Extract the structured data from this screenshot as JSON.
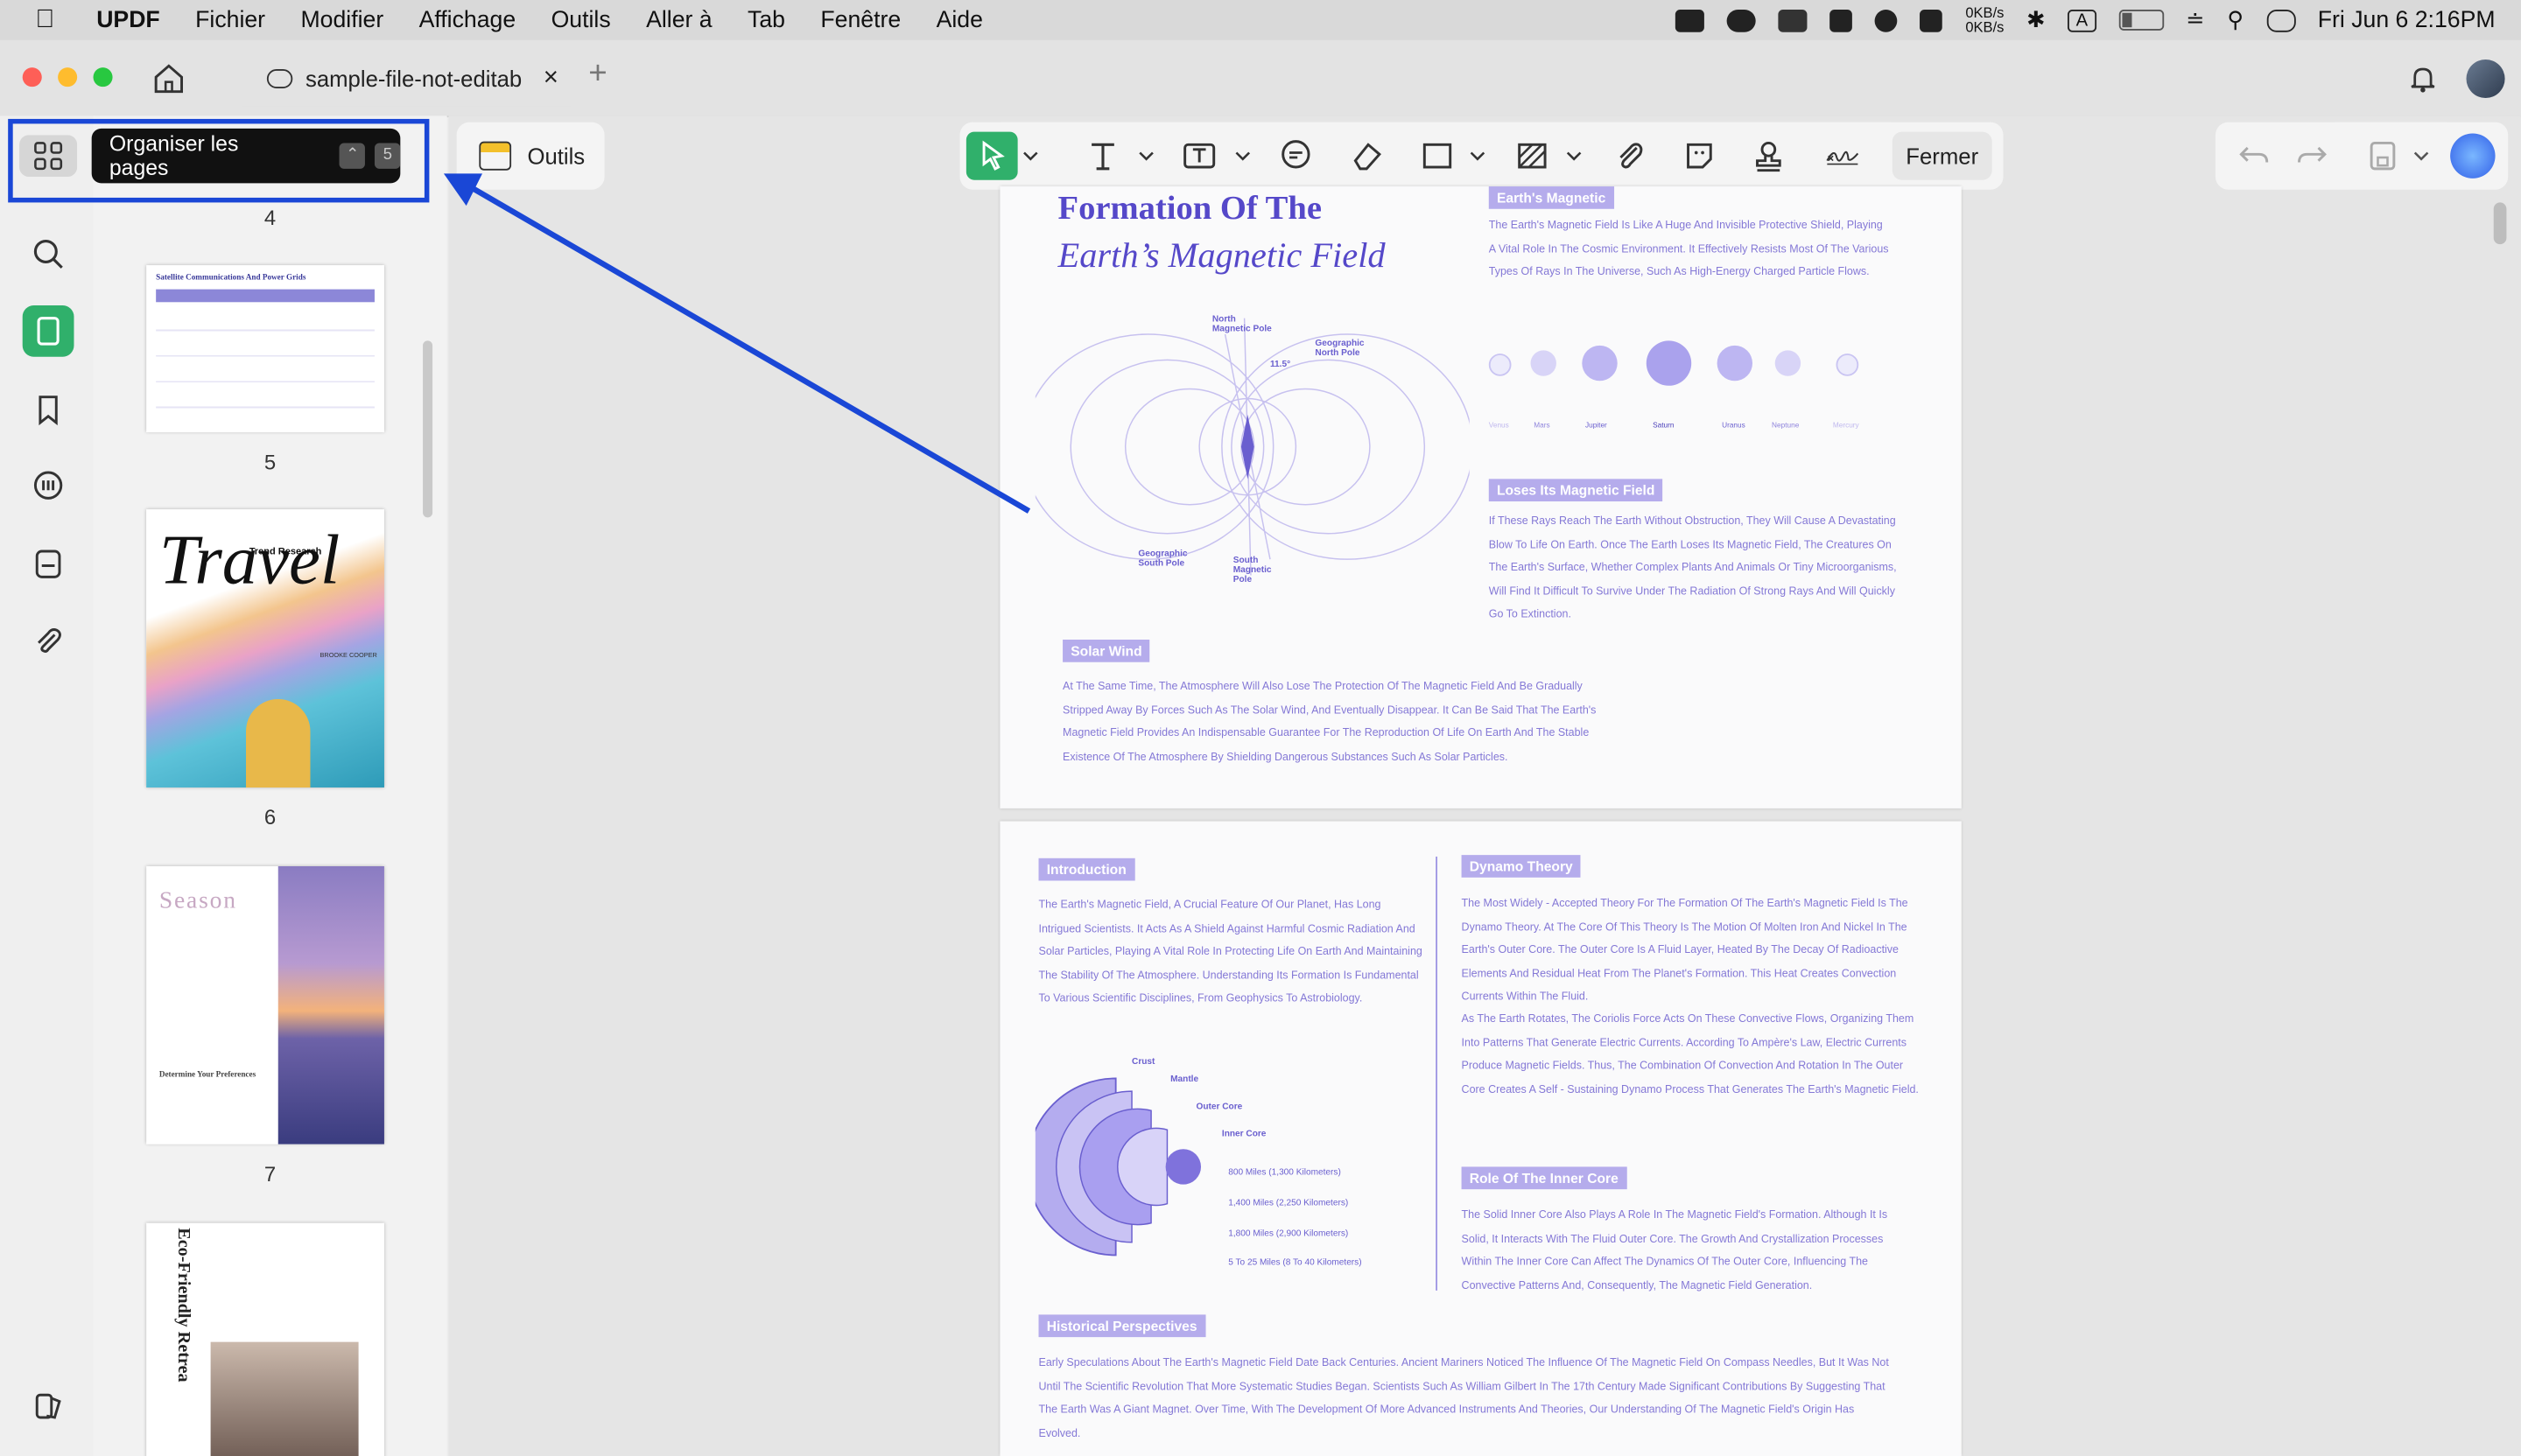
{
  "menubar": {
    "app": "UPDF",
    "items": [
      "Fichier",
      "Modifier",
      "Affichage",
      "Outils",
      "Aller à",
      "Tab",
      "Fenêtre",
      "Aide"
    ],
    "net_up": "0KB/s",
    "net_down": "0KB/s",
    "clock": "Fri Jun 6  2:16PM"
  },
  "tabbar": {
    "doc_tab": "sample-file-not-editab",
    "close": "×",
    "new_tab": "+"
  },
  "tooltip": {
    "label": "Organiser les pages",
    "key1": "⌃",
    "key2": "5"
  },
  "thumbnails": {
    "page_numbers": [
      "4",
      "5",
      "6",
      "7"
    ],
    "t5_title": "Satellite Communications And Power Grids",
    "t6_title": "Travel",
    "t6_sub": "Trend Research",
    "t6_author": "BROOKE COOPER",
    "t7_title": "Season",
    "t7_heading": "Determine Your Preferences",
    "t8_title": "Eco-Friendly Retrea"
  },
  "toolbar": {
    "outils": "Outils",
    "fermer": "Fermer"
  },
  "page1": {
    "title1": "Formation Of The",
    "title2": "Earth’s Magnetic Field",
    "tag1": "Earth's Magnetic",
    "para1": "The Earth's Magnetic Field Is Like A Huge And Invisible Protective Shield, Playing A Vital Role In The Cosmic Environment. It Effectively Resists Most Of The Various Types Of Rays In The Universe, Such As High-Energy Charged Particle Flows.",
    "planets": [
      "Venus",
      "Mars",
      "Jupiter",
      "Saturn",
      "Uranus",
      "Neptune",
      "Mercury"
    ],
    "tag2": "Loses Its Magnetic Field",
    "para2": "If These Rays Reach The Earth Without Obstruction, They Will Cause A Devastating Blow To Life On Earth. Once The Earth Loses Its Magnetic Field, The Creatures On The Earth's Surface, Whether Complex Plants And Animals Or Tiny Microorganisms, Will Find It Difficult To Survive Under The Radiation Of Strong Rays And Will Quickly Go To Extinction.",
    "tag3": "Solar Wind",
    "para3": "At The Same Time, The Atmosphere Will Also Lose The Protection Of The Magnetic Field And Be Gradually Stripped Away By Forces Such As The Solar Wind, And Eventually Disappear. It Can Be Said That The Earth's Magnetic Field Provides An Indispensable Guarantee For The Reproduction Of Life On Earth And The Stable Existence Of The Atmosphere By Shielding Dangerous Substances Such As Solar Particles.",
    "diagram_labels": {
      "north_mag": "North Magnetic Pole",
      "geo_north": "Geographic North Pole",
      "geo_south": "Geographic South Pole",
      "south_mag": "South Magnetic Pole",
      "angle": "11.5°"
    }
  },
  "page2": {
    "tag_intro": "Introduction",
    "intro": "The Earth's Magnetic Field, A Crucial Feature Of Our Planet, Has Long Intrigued Scientists. It Acts As A Shield Against Harmful Cosmic Radiation And Solar Particles, Playing A Vital Role In Protecting Life On Earth And Maintaining The Stability Of The Atmosphere. Understanding Its Formation Is Fundamental To Various Scientific Disciplines, From Geophysics To Astrobiology.",
    "tag_dynamo": "Dynamo Theory",
    "dynamo": "The Most Widely - Accepted Theory For The Formation Of The Earth's Magnetic Field Is The Dynamo Theory. At The Core Of This Theory Is The Motion Of Molten Iron And Nickel In The Earth's Outer Core. The Outer Core Is A Fluid Layer, Heated By The Decay Of Radioactive Elements And Residual Heat From The Planet's Formation. This Heat Creates Convection Currents Within The Fluid.",
    "dynamo2": "As The Earth Rotates, The Coriolis Force Acts On These Convective Flows, Organizing Them Into Patterns That Generate Electric Currents. According To Ampère's Law, Electric Currents Produce Magnetic Fields. Thus, The Combination Of Convection And Rotation In The Outer Core Creates A Self - Sustaining Dynamo Process That Generates The Earth's Magnetic Field.",
    "tag_inner": "Role Of The Inner Core",
    "inner": "The Solid Inner Core Also Plays A Role In The Magnetic Field's Formation. Although It Is Solid, It Interacts With The Fluid Outer Core. The Growth And Crystallization Processes Within The Inner Core Can Affect The Dynamics Of The Outer Core, Influencing The Convective Patterns And, Consequently, The Magnetic Field Generation.",
    "tag_hist": "Historical Perspectives",
    "hist": "Early Speculations About The Earth's Magnetic Field Date Back Centuries. Ancient Mariners Noticed The Influence Of The Magnetic Field On Compass Needles, But It Was Not Until The Scientific Revolution That More Systematic Studies Began. Scientists Such As William Gilbert In The 17th Century Made Significant Contributions By Suggesting That The Earth Was A Giant Magnet. Over Time, With The Development Of More Advanced Instruments And Theories, Our Understanding Of The Magnetic Field's Origin Has Evolved.",
    "layers": {
      "crust": "Crust",
      "mantle": "Mantle",
      "outer": "Outer Core",
      "inner": "Inner Core",
      "d1": "800 Miles (1,300 Kilometers)",
      "d2": "1,400 Miles (2,250 Kilometers)",
      "d3": "1,800 Miles (2,900 Kilometers)",
      "d4": "5 To 25 Miles (8 To 40 Kilometers)"
    }
  },
  "colors": {
    "accent": "#30b06b",
    "annotation": "#1a47d6",
    "doc_purple": "#5548c9"
  }
}
